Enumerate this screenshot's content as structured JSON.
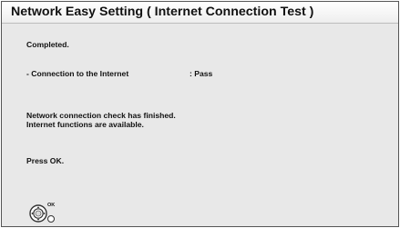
{
  "header": {
    "title": "Network Easy Setting ( Internet Connection Test )"
  },
  "content": {
    "status": "Completed.",
    "check_label": "- Connection to the Internet",
    "check_result": ": Pass",
    "message_line1": "Network connection check has finished.",
    "message_line2": "Internet functions are available.",
    "instruction": "Press OK."
  },
  "controls": {
    "ok_label": "OK",
    "icons": [
      "remote-dpad-icon",
      "select-circle-icon"
    ]
  },
  "colors": {
    "background": "#e8e8e8",
    "title_bar": "#f5f5f5",
    "text": "#111111",
    "border": "#555555"
  }
}
